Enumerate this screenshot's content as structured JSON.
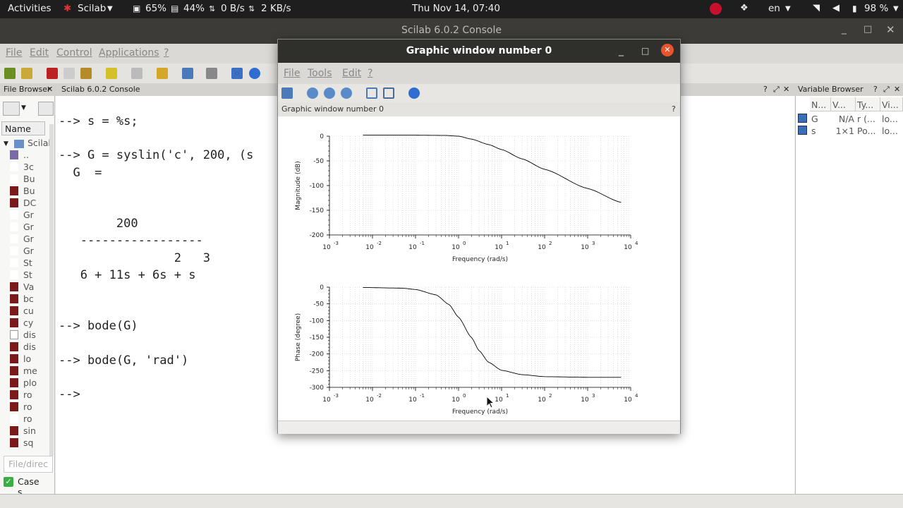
{
  "topbar": {
    "activities": "Activities",
    "app": "Scilab",
    "cpu": "65%",
    "mem": "44%",
    "net_up": "0 B/s",
    "net_down": "2 KB/s",
    "clock": "Thu Nov 14, 07:40",
    "lang": "en",
    "battery": "98 %"
  },
  "main_window": {
    "title": "Scilab 6.0.2 Console",
    "menu": [
      "File",
      "Edit",
      "Control",
      "Applications",
      "?"
    ]
  },
  "panels": {
    "file_browser": "File Browser",
    "console": "Scilab 6.0.2 Console",
    "variable_browser": "Variable Browser"
  },
  "file_browser": {
    "column": "Name",
    "root": "Scilab",
    "items": [
      "..",
      "3c",
      "Bu",
      "Bu",
      "DC",
      "Gr",
      "Gr",
      "Gr",
      "Gr",
      "St",
      "St",
      "Va",
      "bc",
      "cu",
      "cy",
      "dis",
      "dis",
      "lo",
      "me",
      "plo",
      "ro",
      "ro",
      "ro",
      "sin",
      "sq"
    ],
    "filter_placeholder": "File/direc",
    "case_label": "Case s..."
  },
  "console": {
    "lines": [
      "--> s = %s;",
      "",
      "--> G = syslin('c', 200, (s",
      "  G  =",
      "",
      "",
      "        200",
      "   -----------------",
      "                2   3",
      "   6 + 11s + 6s + s",
      "",
      "",
      "--> bode(G)",
      "",
      "--> bode(G, 'rad')",
      "",
      "-->"
    ]
  },
  "variable_browser": {
    "headers": [
      "N...",
      "V...",
      "Ty...",
      "Vi..."
    ],
    "rows": [
      [
        "G",
        "N/A",
        "r (...",
        "lo..."
      ],
      [
        "s",
        "1×1",
        "Po...",
        "lo..."
      ]
    ]
  },
  "graphic_window": {
    "title": "Graphic window number 0",
    "menu": [
      "File",
      "Tools",
      "Edit",
      "?"
    ],
    "header": "Graphic window number 0",
    "help": "?"
  },
  "chart_data": [
    {
      "type": "line",
      "xscale": "log",
      "xlim": [
        0.001,
        10000
      ],
      "ylim": [
        -200,
        0
      ],
      "xlabel": "Frequency (rad/s)",
      "ylabel": "Magnitude (dB)",
      "xticks": [
        "10^-3",
        "10^-2",
        "10^-1",
        "10^0",
        "10^1",
        "10^2",
        "10^3",
        "10^4"
      ],
      "yticks": [
        "-200",
        "-150",
        "-100",
        "-50",
        "0"
      ],
      "grid": true,
      "x": [
        0.006,
        0.1,
        0.5,
        1,
        2,
        5,
        10,
        30,
        100,
        1000,
        6000
      ],
      "y": [
        2.0,
        2.0,
        1.5,
        0,
        -6,
        -17,
        -27,
        -46,
        -67,
        -106,
        -134
      ]
    },
    {
      "type": "line",
      "xscale": "log",
      "xlim": [
        0.001,
        10000
      ],
      "ylim": [
        -300,
        0
      ],
      "xlabel": "Frequency (rad/s)",
      "ylabel": "Phase (degree)",
      "xticks": [
        "10^-3",
        "10^-2",
        "10^-1",
        "10^0",
        "10^1",
        "10^2",
        "10^3",
        "10^4"
      ],
      "yticks": [
        "-300",
        "-250",
        "-200",
        "-150",
        "-100",
        "-50",
        "0"
      ],
      "grid": true,
      "x": [
        0.006,
        0.05,
        0.1,
        0.3,
        0.6,
        1,
        2,
        3,
        5,
        10,
        30,
        100,
        1000,
        6000
      ],
      "y": [
        -1,
        -3,
        -7,
        -23,
        -52,
        -90,
        -151,
        -190,
        -225,
        -249,
        -262,
        -268,
        -270,
        -270
      ]
    }
  ]
}
